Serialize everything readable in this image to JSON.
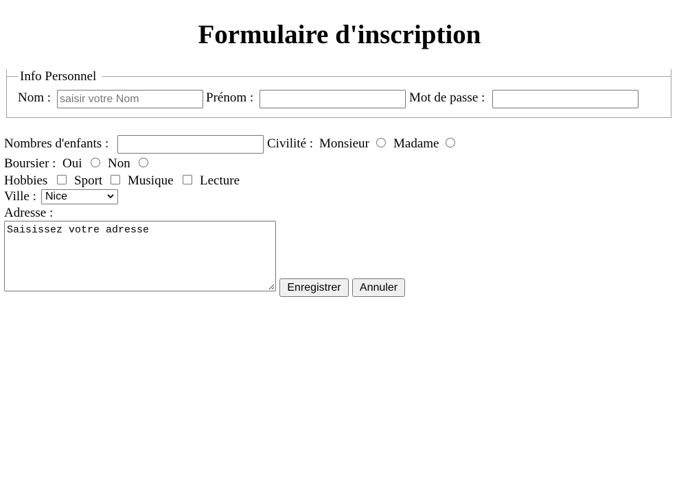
{
  "title": "Formulaire d'inscription",
  "personal_info": {
    "legend": "Info Personnel",
    "nom": {
      "label": "Nom :",
      "placeholder": "saisir votre Nom",
      "value": ""
    },
    "prenom": {
      "label": "Prénom :",
      "value": ""
    },
    "password": {
      "label": "Mot de passe :",
      "value": ""
    }
  },
  "children": {
    "label": "Nombres d'enfants :",
    "value": ""
  },
  "civility": {
    "label": "Civilité :",
    "options": [
      "Monsieur",
      "Madame"
    ]
  },
  "scholarship": {
    "label": "Boursier :",
    "options": [
      "Oui",
      "Non"
    ]
  },
  "hobbies": {
    "label": "Hobbies",
    "options": [
      "Sport",
      "Musique",
      "Lecture"
    ]
  },
  "city": {
    "label": "Ville :",
    "selected": "Nice"
  },
  "address": {
    "label": "Adresse :",
    "value": "Saisissez votre adresse"
  },
  "buttons": {
    "save": "Enregistrer",
    "cancel": "Annuler"
  },
  "colors": {
    "border": "#767676",
    "fieldset_border": "#a0a0a0",
    "button_bg": "#efefef",
    "placeholder": "#757575"
  }
}
